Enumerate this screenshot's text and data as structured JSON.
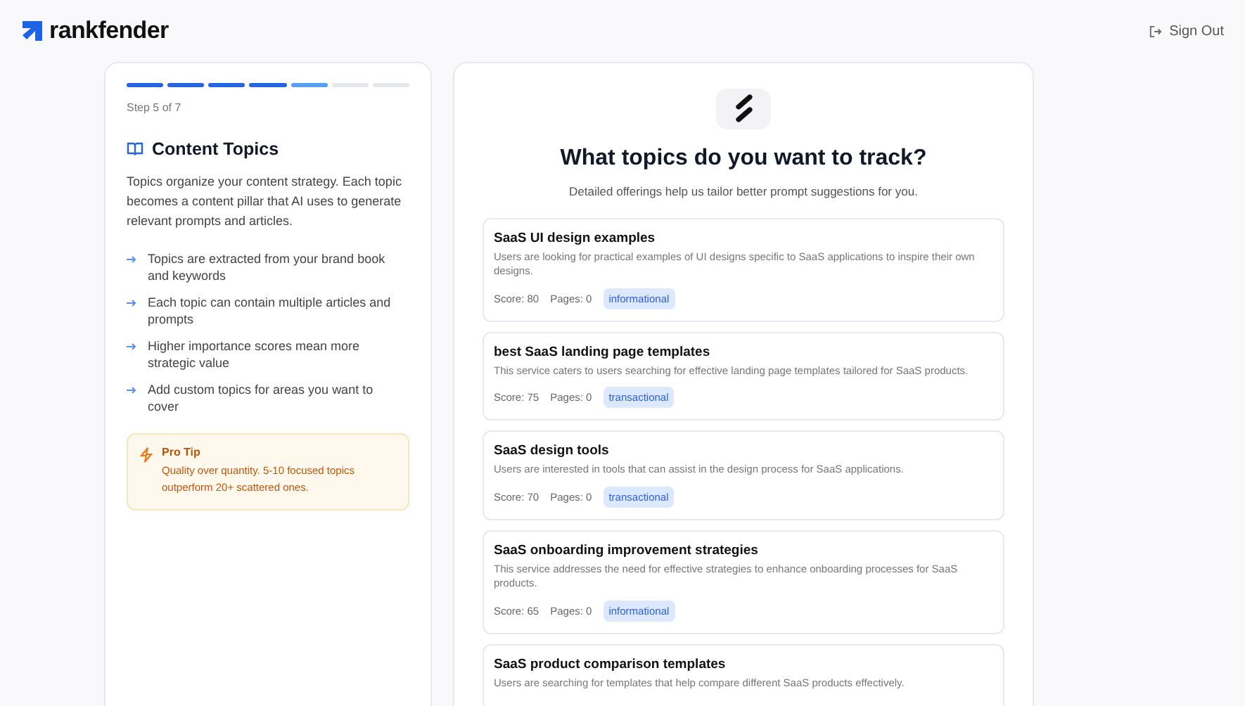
{
  "header": {
    "brand": "rankfender",
    "sign_out": "Sign Out"
  },
  "sidebar": {
    "steps": [
      {
        "kind": "done"
      },
      {
        "kind": "done"
      },
      {
        "kind": "done"
      },
      {
        "kind": "done"
      },
      {
        "kind": "current"
      },
      {
        "kind": "pending"
      },
      {
        "kind": "pending"
      }
    ],
    "step_label": "Step 5 of 7",
    "title": "Content Topics",
    "intro": "Topics organize your content strategy. Each topic becomes a content pillar that AI uses to generate relevant prompts and articles.",
    "points": [
      "Topics are extracted from your brand book and keywords",
      "Each topic can contain multiple articles and prompts",
      "Higher importance scores mean more strategic value",
      "Add custom topics for areas you want to cover"
    ],
    "tip": {
      "title": "Pro Tip",
      "text": "Quality over quantity. 5-10 focused topics outperform 20+ scattered ones."
    }
  },
  "main": {
    "heading": "What topics do you want to track?",
    "subheading": "Detailed offerings help us tailor better prompt suggestions for you.",
    "topics": [
      {
        "title": "SaaS UI design examples",
        "description": "Users are looking for practical examples of UI designs specific to SaaS applications to inspire their own designs.",
        "score": "Score: 80",
        "pages": "Pages: 0",
        "tag": "informational"
      },
      {
        "title": "best SaaS landing page templates",
        "description": "This service caters to users searching for effective landing page templates tailored for SaaS products.",
        "score": "Score: 75",
        "pages": "Pages: 0",
        "tag": "transactional"
      },
      {
        "title": "SaaS design tools",
        "description": "Users are interested in tools that can assist in the design process for SaaS applications.",
        "score": "Score: 70",
        "pages": "Pages: 0",
        "tag": "transactional"
      },
      {
        "title": "SaaS onboarding improvement strategies",
        "description": "This service addresses the need for effective strategies to enhance onboarding processes for SaaS products.",
        "score": "Score: 65",
        "pages": "Pages: 0",
        "tag": "informational"
      },
      {
        "title": "SaaS product comparison templates",
        "description": "Users are searching for templates that help compare different SaaS products effectively."
      }
    ]
  }
}
